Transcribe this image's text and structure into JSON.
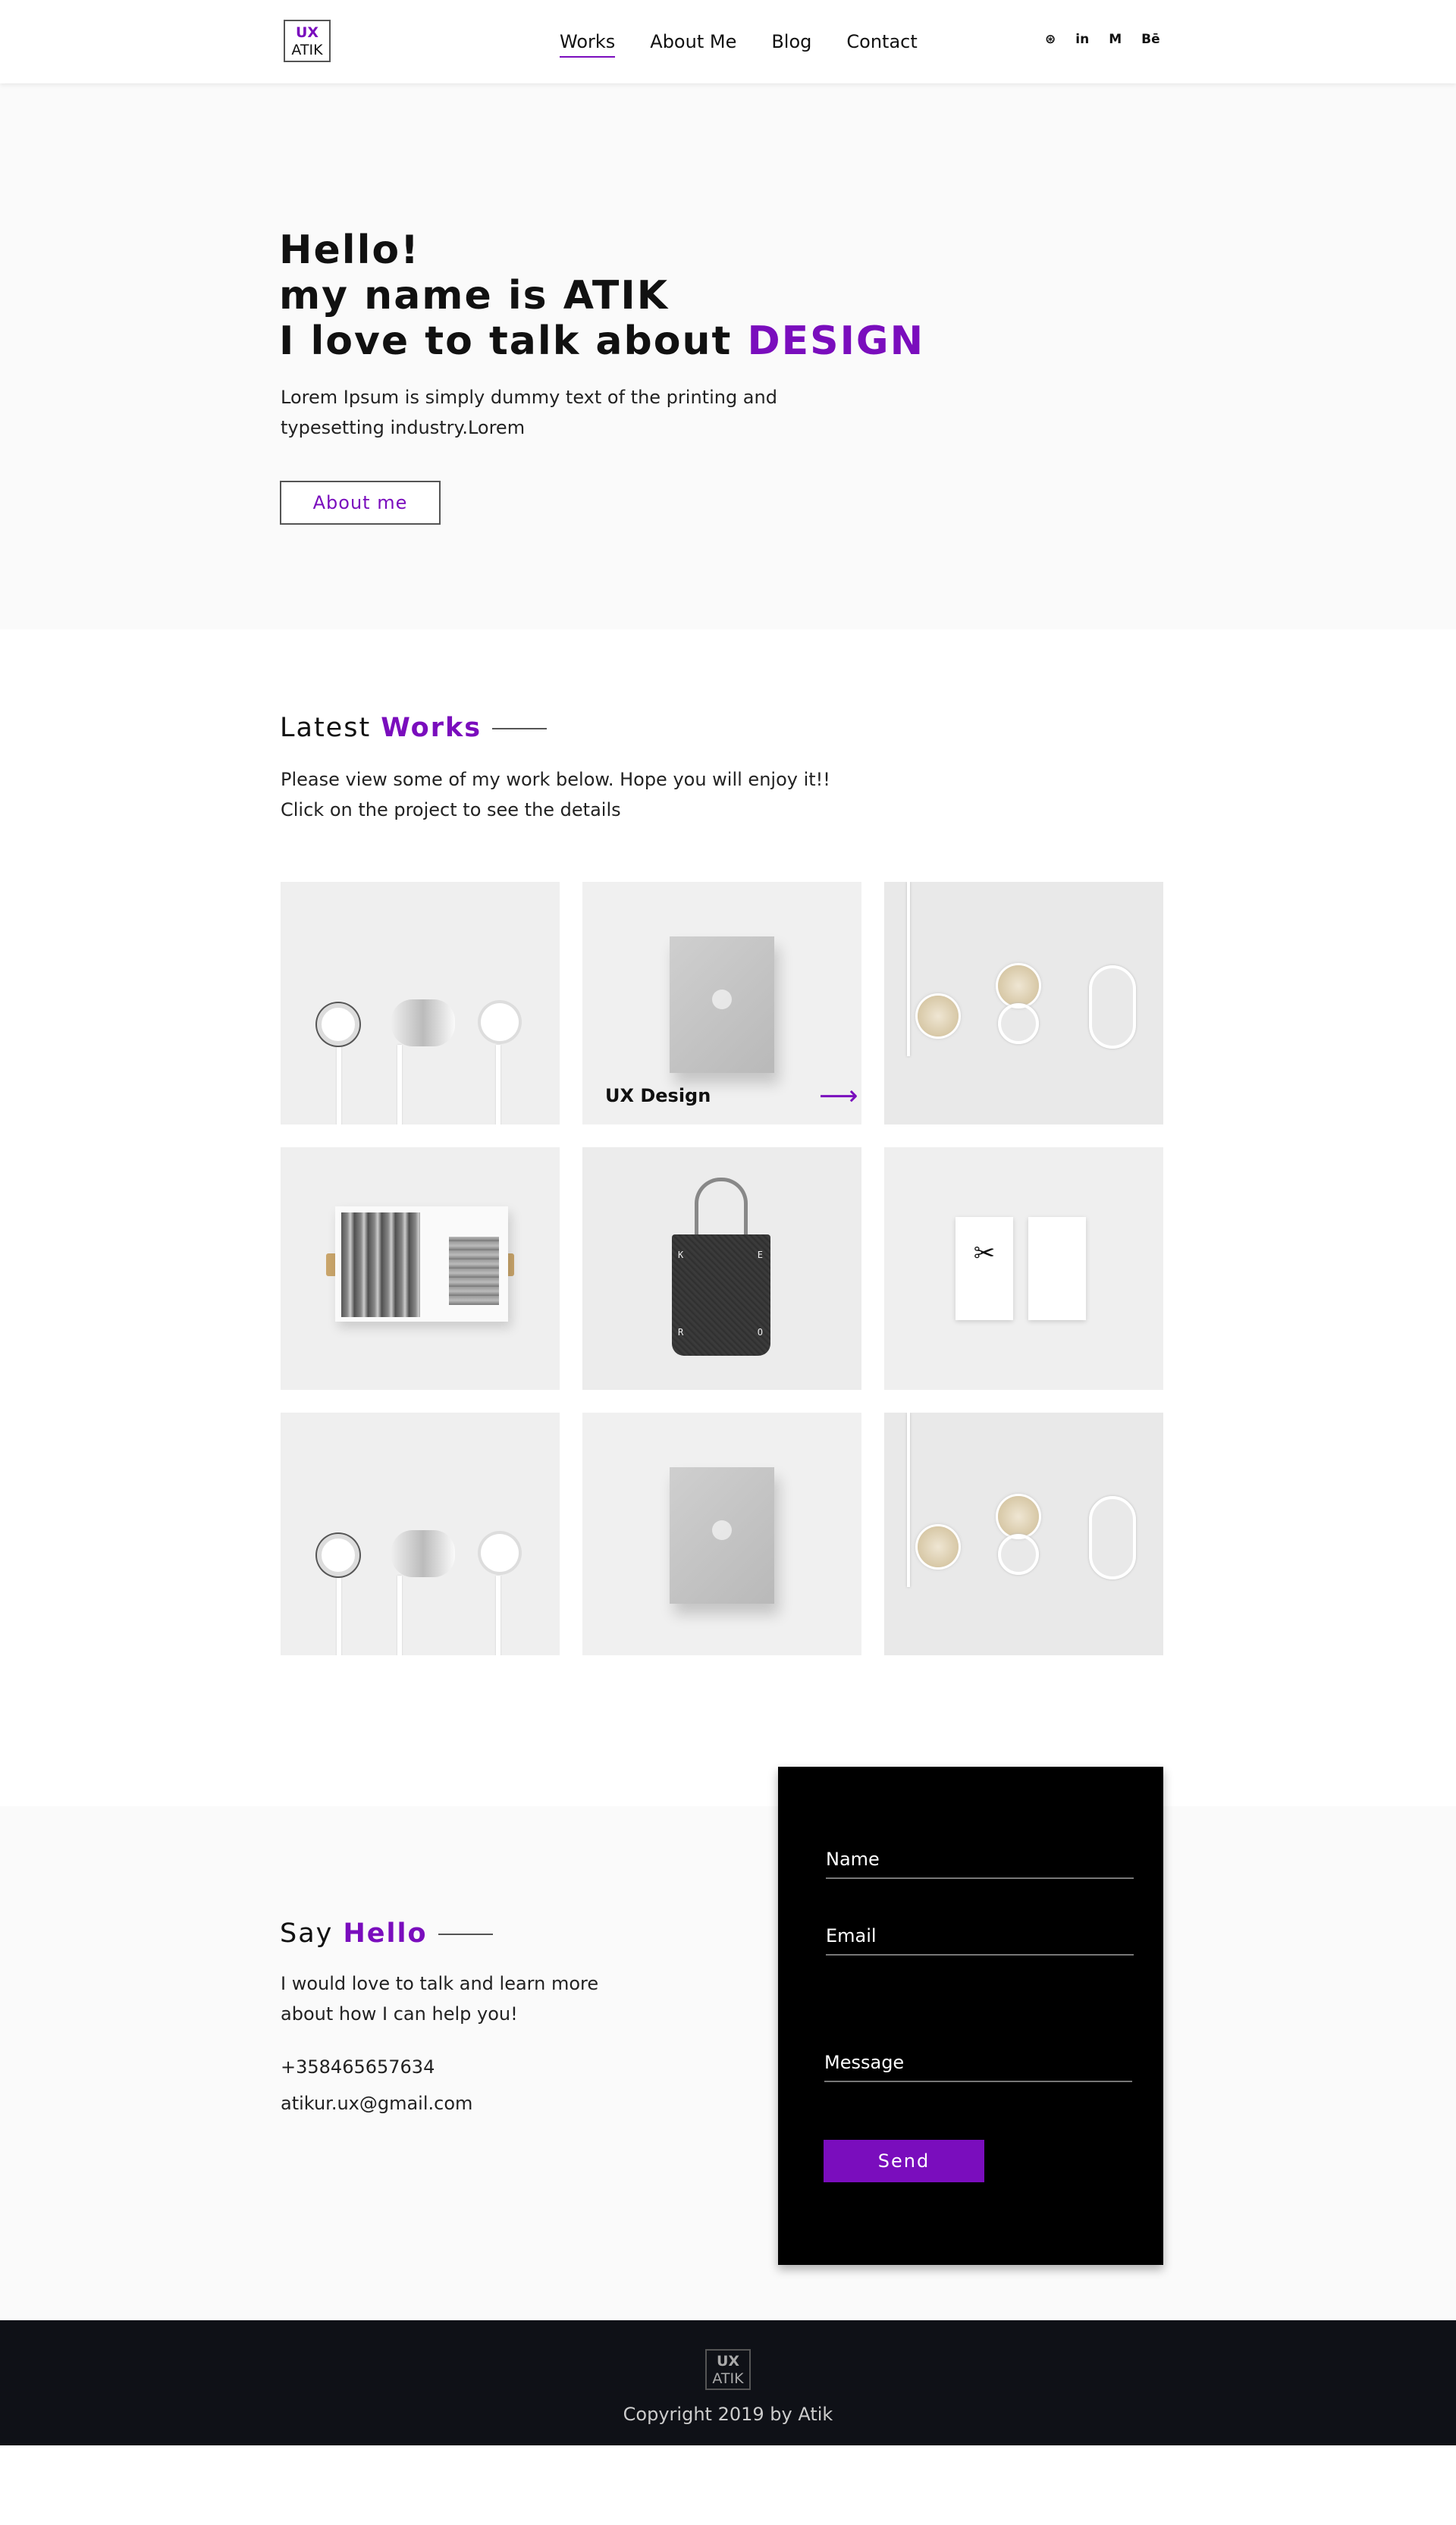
{
  "nav": {
    "logo_top": "UX",
    "logo_bottom": "ATIK",
    "items": [
      {
        "label": "Works"
      },
      {
        "label": "About Me"
      },
      {
        "label": "Blog"
      },
      {
        "label": "Contact"
      }
    ],
    "social": [
      "github-icon",
      "linkedin-icon",
      "medium-icon",
      "behance-icon"
    ],
    "social_glyphs": [
      "⊛",
      "in",
      "M",
      "Bē"
    ]
  },
  "hero": {
    "line1": "Hello!",
    "line2": "my name is ATIK",
    "line3_prefix": "I love to talk about ",
    "line3_accent": "DESIGN",
    "text": "Lorem Ipsum is simply dummy text of the printing and typesetting industry.Lorem",
    "button": "About me"
  },
  "works": {
    "title_prefix": "Latest ",
    "title_accent": "Works",
    "intro_line1": "Please view some of my work below. Hope you will enjoy it!!",
    "intro_line2": "Click on the project to see the details",
    "hover_caption": "UX Design",
    "hover_arrow": "⟶"
  },
  "contact": {
    "title_prefix": "Say ",
    "title_accent": "Hello",
    "message": "I would love to talk and learn more about how I can help you!",
    "phone": "+358465657634",
    "email": "atikur.ux@gmail.com",
    "form": {
      "name_placeholder": "Name",
      "email_placeholder": "Email",
      "message_placeholder": "Message",
      "send": "Send"
    }
  },
  "footer": {
    "logo_top": "UX",
    "logo_bottom": "ATIK",
    "copyright": "Copyright 2019 by Atik"
  },
  "colors": {
    "accent": "#7a0dbd",
    "footer_bg": "#0f1117",
    "hero_bg": "#fafafa"
  }
}
